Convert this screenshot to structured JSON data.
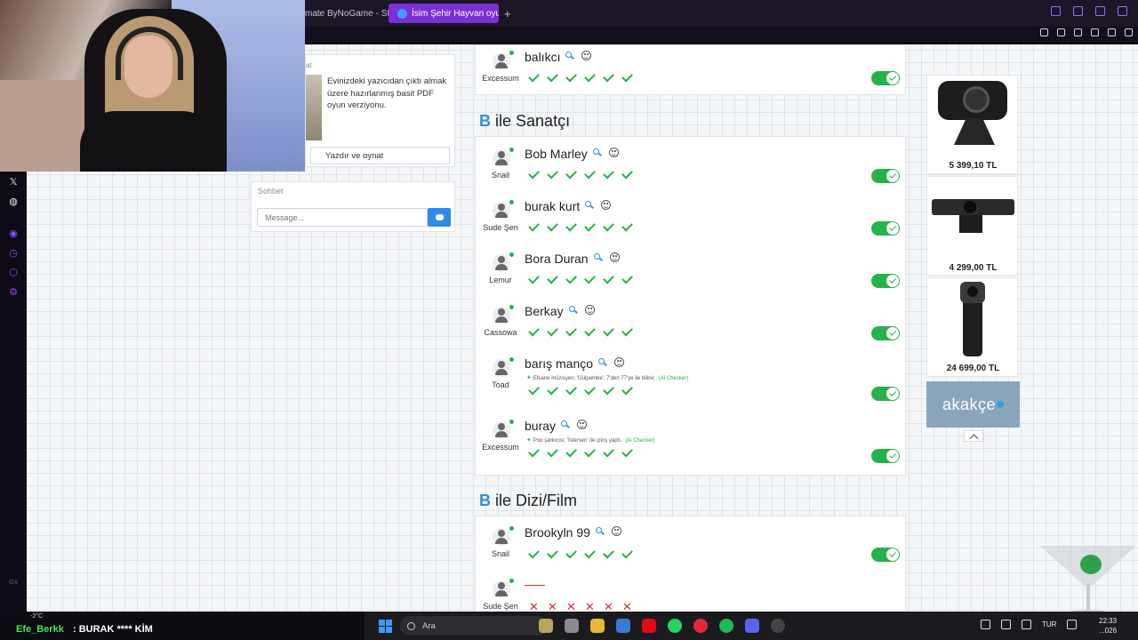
{
  "browser": {
    "tabs": [
      {
        "label": "mate ByNoGame - Strea",
        "active": false
      },
      {
        "label": "İsim Şehir Hayvan oyunu",
        "active": true
      }
    ]
  },
  "left_panel": {
    "pdf_card": {
      "tag": "at",
      "text": "Evinizdeki yazıcıdan çıktı almak üzere hazırlanmış basit PDF oyun verziyonu.",
      "button": "Yazdır ve oynat"
    },
    "chat": {
      "title": "Sohbet",
      "placeholder": "Message..."
    }
  },
  "game": {
    "balikci_row": {
      "answer": "balıkcı",
      "player": "Excessum",
      "votes": [
        "ok",
        "ok",
        "ok",
        "ok",
        "ok",
        "ok"
      ]
    },
    "sections": [
      {
        "letter": "B",
        "category": "ile Sanatçı",
        "rows": [
          {
            "player": "Snail",
            "answer": "Bob Marley",
            "votes": [
              "ok",
              "ok",
              "ok",
              "ok",
              "ok",
              "ok"
            ]
          },
          {
            "player": "Sude Şen",
            "answer": "burak kurt",
            "votes": [
              "ok",
              "ok",
              "ok",
              "ok",
              "ok",
              "ok"
            ]
          },
          {
            "player": "Lemur",
            "answer": "Bora Duran",
            "votes": [
              "ok",
              "ok",
              "ok",
              "ok",
              "ok",
              "ok"
            ]
          },
          {
            "player": "Cassowa",
            "answer": "Berkay",
            "votes": [
              "ok",
              "ok",
              "ok",
              "ok",
              "ok",
              "ok"
            ]
          },
          {
            "player": "Toad",
            "answer": "barış manço",
            "hint": "Efsane müzisyen; 'Gülpembe', 7'den 77'ye ile bilinir.",
            "checker": "(Ai Checker)",
            "votes": [
              "ok",
              "ok",
              "ok",
              "ok",
              "ok",
              "ok"
            ]
          },
          {
            "player": "Excessum",
            "answer": "buray",
            "hint": "Pop şarkıcısı; 'İstersen' ile çıkış yaptı.",
            "checker": "(Ai Checker)",
            "votes": [
              "ok",
              "ok",
              "ok",
              "ok",
              "ok",
              "ok"
            ]
          }
        ]
      },
      {
        "letter": "B",
        "category": "ile Dizi/Film",
        "rows": [
          {
            "player": "Snail",
            "answer": "Brookyln 99",
            "votes": [
              "ok",
              "ok",
              "ok",
              "ok",
              "ok",
              "ok"
            ]
          },
          {
            "player": "Sude Şen",
            "answer": "",
            "votes": [
              "bad",
              "bad",
              "bad",
              "bad",
              "bad",
              "bad"
            ]
          }
        ]
      }
    ]
  },
  "ads": {
    "items": [
      {
        "price": "5 399,10 TL"
      },
      {
        "price": "4 299,00 TL"
      },
      {
        "price": "24 699,00 TL"
      }
    ],
    "brand": "akakçe"
  },
  "ticker": {
    "weather": "-2°C",
    "user": "Efe_Berkk",
    "message": ": BURAK **** KİM"
  },
  "taskbar": {
    "search_placeholder": "Ara",
    "language": "TUR",
    "time": "22:33",
    "date": "...026"
  },
  "rail": {
    "label": "GX"
  },
  "colors": {
    "accent_blue": "#2f8fd8",
    "ok_green": "#27b14a",
    "bad_red": "#e0283a",
    "tab_active": "#7b2fd6"
  }
}
